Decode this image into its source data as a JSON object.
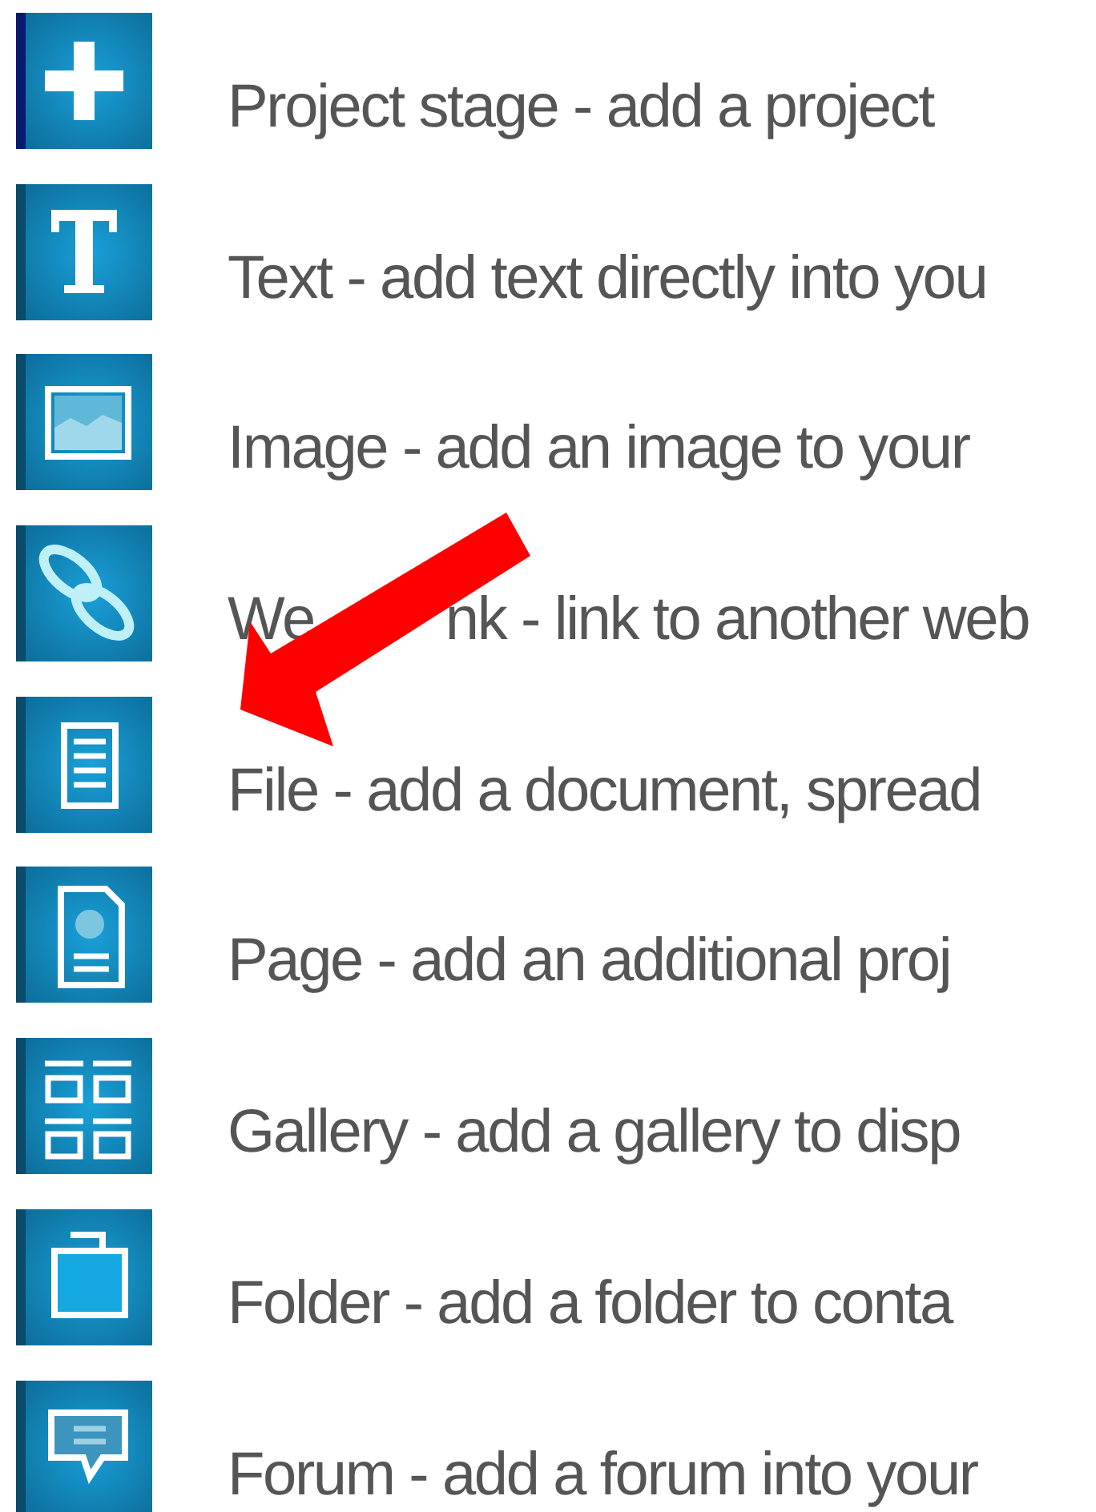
{
  "items": [
    {
      "kind": "plus",
      "parts": [
        "Project stage - add a project"
      ]
    },
    {
      "kind": "text",
      "parts": [
        "Text - add text directly into you"
      ]
    },
    {
      "kind": "image",
      "parts": [
        "Image - add an image to your"
      ]
    },
    {
      "kind": "link",
      "parts": [
        "We",
        "nk - link to another web"
      ]
    },
    {
      "kind": "file",
      "parts": [
        "File - add a document, spread"
      ]
    },
    {
      "kind": "page",
      "parts": [
        "Page - add an additional proj"
      ]
    },
    {
      "kind": "gallery",
      "parts": [
        "Gallery - add a gallery to disp"
      ]
    },
    {
      "kind": "folder",
      "parts": [
        "Folder - add a folder to conta"
      ]
    },
    {
      "kind": "forum",
      "parts": [
        "Forum - add a forum into your"
      ]
    }
  ],
  "annotation": {
    "kind": "arrow",
    "color": "#ff0000"
  }
}
